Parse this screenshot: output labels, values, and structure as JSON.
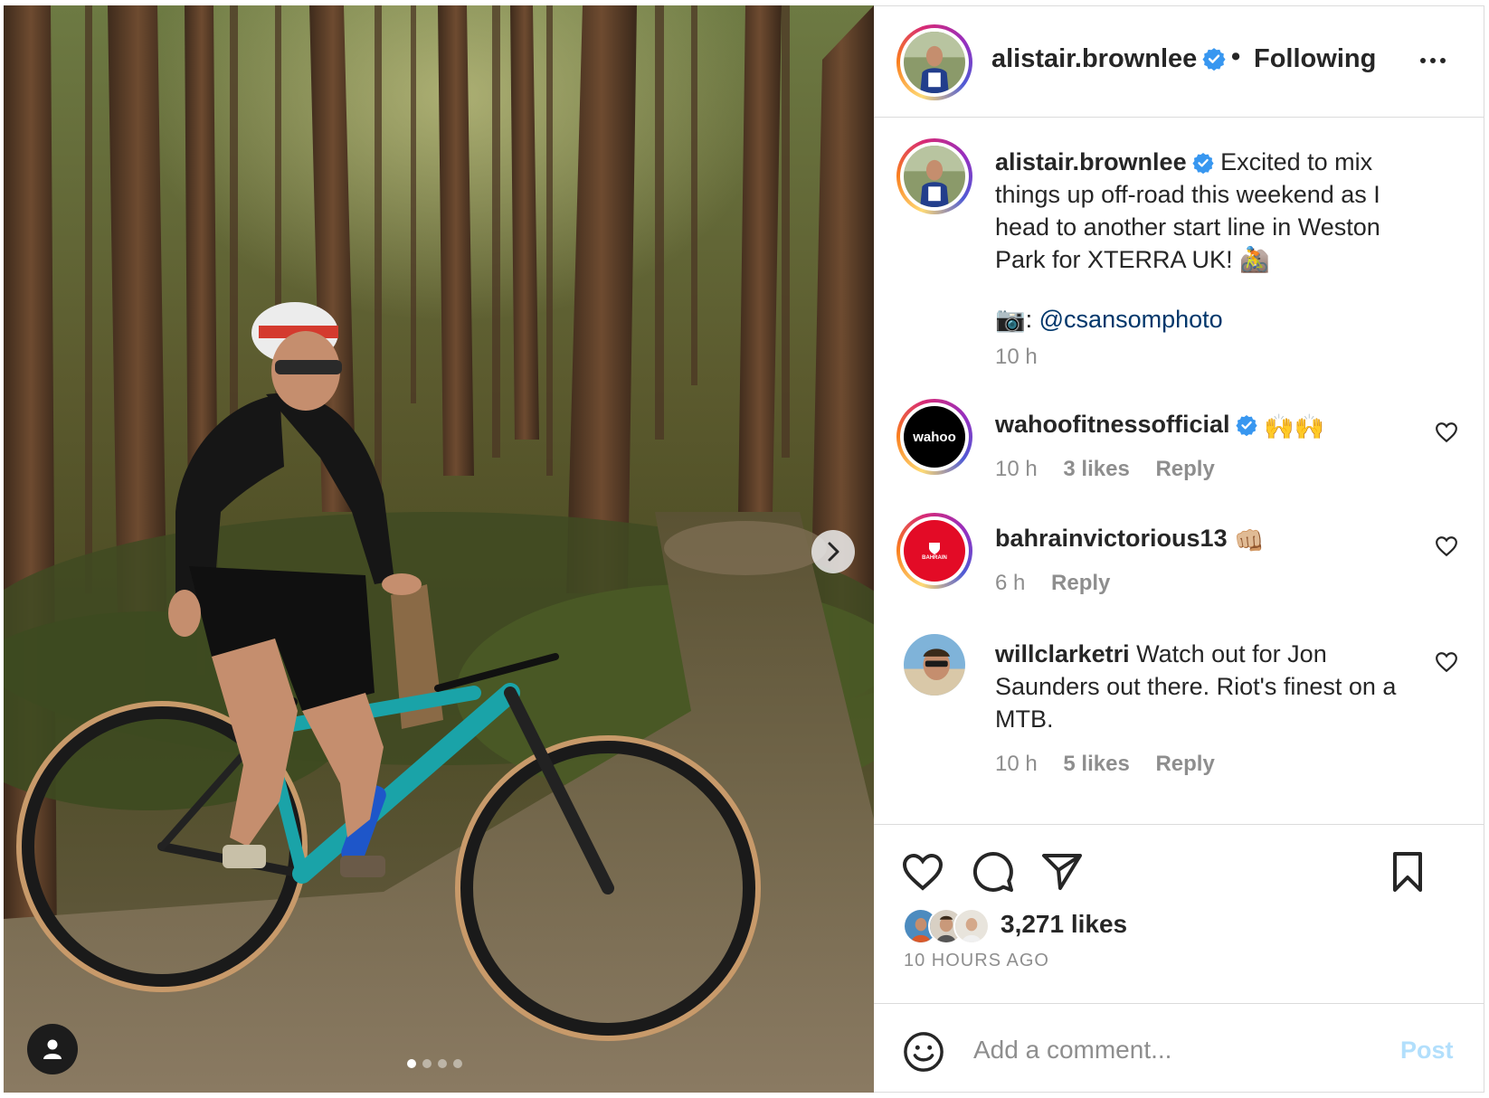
{
  "post": {
    "author": "alistair.brownlee",
    "follow_status": "Following",
    "separator": "•",
    "caption_line": "Excited to mix things up off-road this weekend as I head to another start line in Weston Park for XTERRA UK! 🚵",
    "credit_prefix": "📷:",
    "credit_mention": "@csansomphoto",
    "caption_time": "10 h"
  },
  "comments": [
    {
      "username": "wahoofitnessofficial",
      "verified": true,
      "text": "🙌🙌",
      "time": "10 h",
      "likes": "3 likes",
      "reply": "Reply",
      "avatar_text": "wahoo"
    },
    {
      "username": "bahrainvictorious13",
      "verified": false,
      "text": "👊🏼",
      "time": "6 h",
      "likes": "",
      "reply": "Reply",
      "avatar_text": "BAHRAIN"
    },
    {
      "username": "willclarketri",
      "verified": false,
      "text": "Watch out for Jon Saunders out there. Riot's finest on a MTB.",
      "time": "10 h",
      "likes": "5 likes",
      "reply": "Reply"
    }
  ],
  "actions": {
    "likes_count": "3,271 likes",
    "time_ago": "10 HOURS AGO"
  },
  "comment_box": {
    "placeholder": "Add a comment...",
    "post_label": "Post"
  },
  "carousel": {
    "total": 4,
    "active": 1
  },
  "colors": {
    "accent": "#0095f6",
    "verified": "#3897f0",
    "text": "#262626",
    "muted": "#8e8e8e",
    "mention": "#00376b",
    "post_disabled": "#b2dffc"
  },
  "icons": [
    "chevron-right-icon",
    "user-tag-icon",
    "verified-badge-icon",
    "more-options-icon",
    "heart-icon",
    "comment-icon",
    "share-icon",
    "bookmark-icon",
    "emoji-icon"
  ]
}
